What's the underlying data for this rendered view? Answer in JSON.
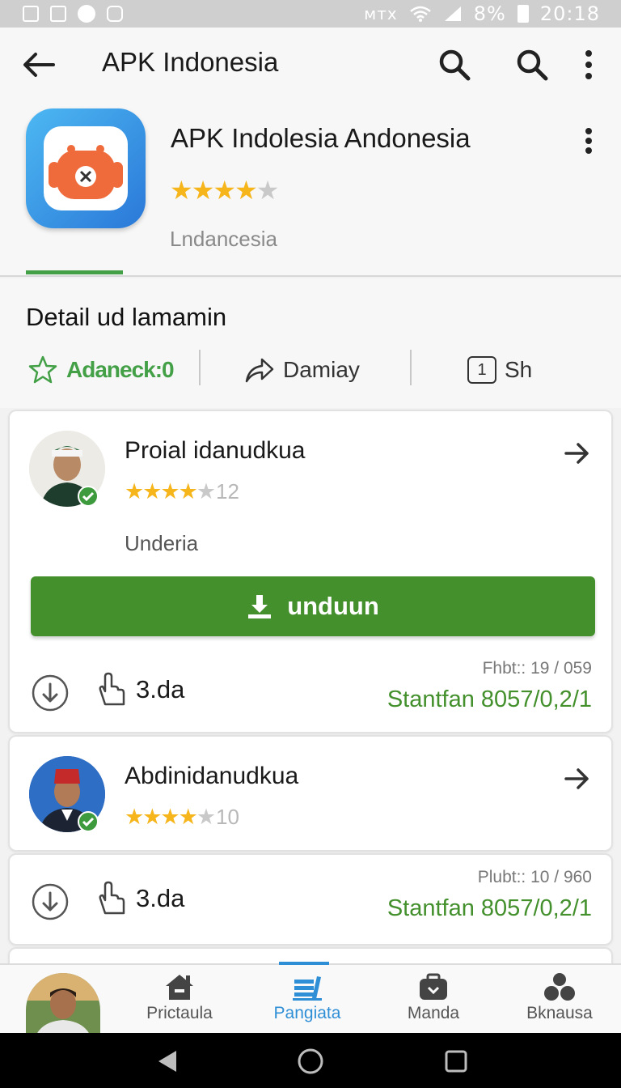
{
  "status_bar": {
    "network": "ᴍᴛx",
    "battery": "8%",
    "time": "20:18"
  },
  "app_bar": {
    "title": "APK Indonesia"
  },
  "app_header": {
    "name": "APK Indolesia Andonesia",
    "rating_stars": "★★★★",
    "rating_partial": "★",
    "developer": "Lndancesia"
  },
  "details": {
    "title": "Detail ud lamamin",
    "actions": [
      {
        "label": "Adaneck:0",
        "icon": "star-outline-icon"
      },
      {
        "label": "Damiay",
        "icon": "share-arrow-icon"
      },
      {
        "label": "Sh",
        "icon": "badge-one-icon",
        "badge": "1"
      }
    ]
  },
  "cards": [
    {
      "title": "Proial idanudkua",
      "stars": "★★★★",
      "stars_dim": "★",
      "rating_count": "12",
      "subtitle": "Underia",
      "download_label": "unduun",
      "count": "3.da",
      "pub": "Fhbt:: 19 / 059",
      "standard": "Stantfan 8057/0,2/1"
    },
    {
      "title": "Abdinidanudkua",
      "stars": "★★★★",
      "stars_dim": "★",
      "rating_count": "10",
      "count": "3.da",
      "pub": "Plubt:: 10 / 960",
      "standard": "Stantfan 8057/0,2/1"
    }
  ],
  "bottom_nav": {
    "items": [
      {
        "label": "Prictaula",
        "icon": "house-icon"
      },
      {
        "label": "Pangiata",
        "icon": "books-icon",
        "active": true
      },
      {
        "label": "Manda",
        "icon": "briefcase-icon"
      },
      {
        "label": "Bknausa",
        "icon": "community-icon"
      }
    ]
  },
  "colors": {
    "accent_green": "#43902d",
    "accent_blue": "#2f8fd6",
    "star": "#f5b51b"
  }
}
